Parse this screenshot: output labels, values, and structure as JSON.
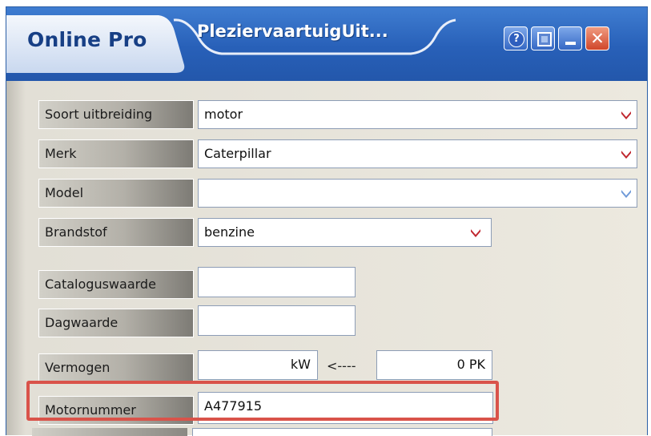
{
  "window": {
    "brand": "Online Pro",
    "title": "PleziervaartuigUit...",
    "buttons": {
      "help_icon": "question-mark",
      "screenshot_icon": "window-capture",
      "minimize_icon": "minimize",
      "close_icon": "close-x"
    }
  },
  "form": {
    "soort_uitbreiding": {
      "label": "Soort uitbreiding",
      "value": "motor"
    },
    "merk": {
      "label": "Merk",
      "value": "Caterpillar"
    },
    "model": {
      "label": "Model",
      "value": ""
    },
    "brandstof": {
      "label": "Brandstof",
      "value": "benzine"
    },
    "cataloguswaarde": {
      "label": "Cataloguswaarde",
      "value": ""
    },
    "dagwaarde": {
      "label": "Dagwaarde",
      "value": ""
    },
    "vermogen": {
      "label": "Vermogen",
      "kw_value": "kW",
      "arrow": "<----",
      "pk_value": "0 PK"
    },
    "motornummer": {
      "label": "Motornummer",
      "value": "A477915"
    }
  },
  "colors": {
    "titlebar_blue": "#2860b8",
    "dropdown_arrow_red": "#c0262e",
    "dropdown_arrow_blue": "#6f9ad8",
    "highlight_red": "#d9534a"
  }
}
